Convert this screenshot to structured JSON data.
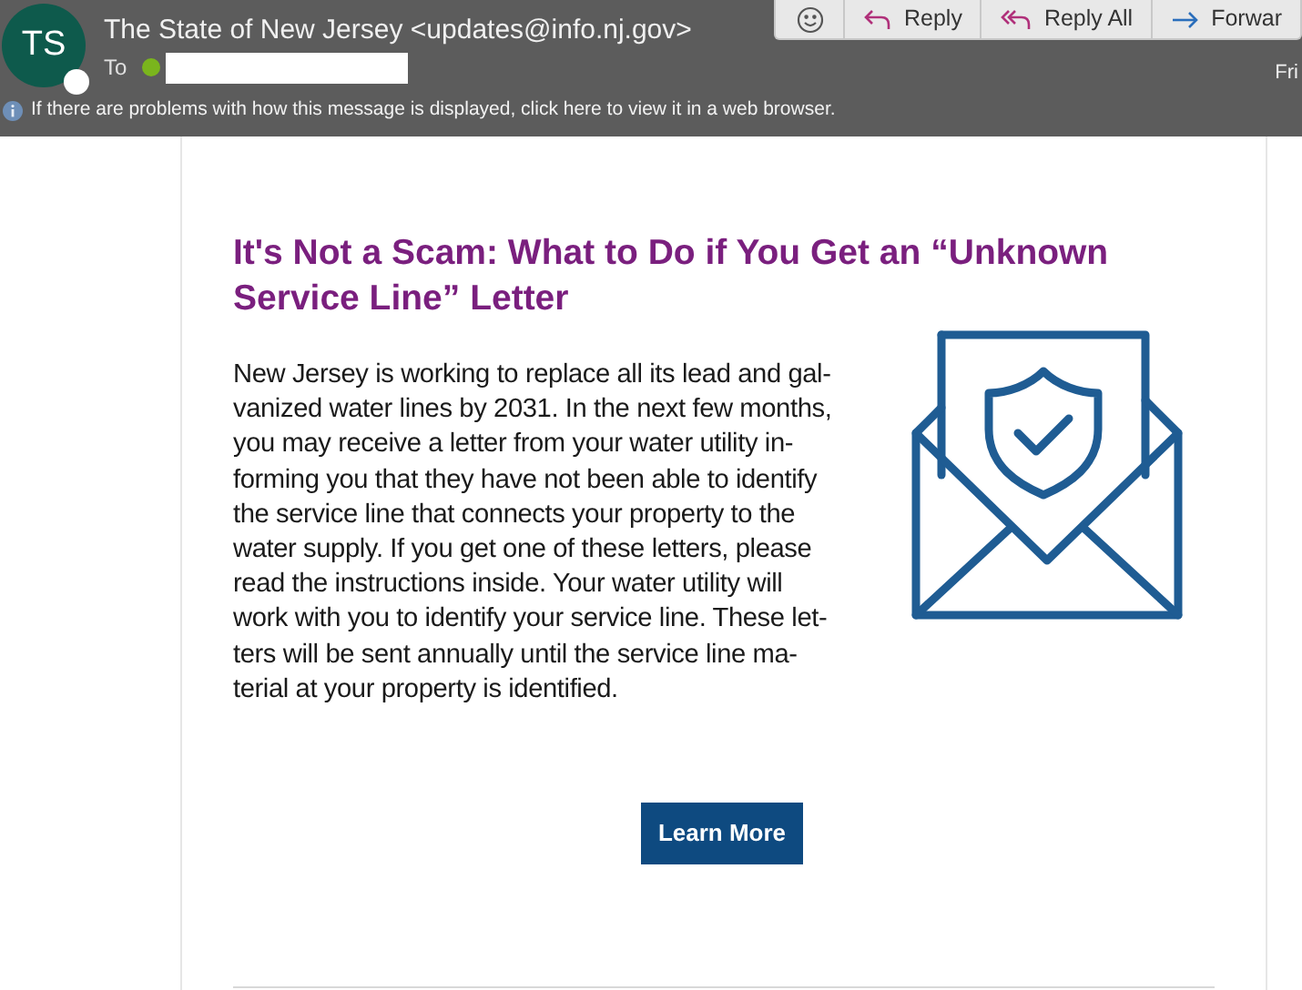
{
  "sender": {
    "initials": "TS",
    "name": "The State of New Jersey <updates@info.nj.gov>",
    "to_label": "To"
  },
  "actions": [
    {
      "kind": "emoji"
    },
    {
      "kind": "reply",
      "label": "Reply"
    },
    {
      "kind": "reply_all",
      "label": "Reply All"
    },
    {
      "kind": "forward",
      "label": "Forwar"
    }
  ],
  "date": "Fri",
  "info_bar": "If there are problems with how this message is displayed, click here to view it in a web browser.",
  "article": {
    "title": "It's Not a Scam: What to Do if You Get an “Unknown Service Line” Letter",
    "body_lines": [
      "New Jersey is working to replace all its lead and gal-",
      "vanized water lines by 2031. In the next few months,",
      "you may receive a letter from your water utility in-",
      "forming you that they have not been able to identify",
      "the service line that connects your property to the",
      "water supply. If you get one of these letters, please",
      "read the instructions inside. Your water utility will",
      "work with you to identify your service line. These let-",
      "ters will be sent annually until the service line ma-",
      "terial at your property is identified."
    ],
    "button": "Learn More"
  }
}
